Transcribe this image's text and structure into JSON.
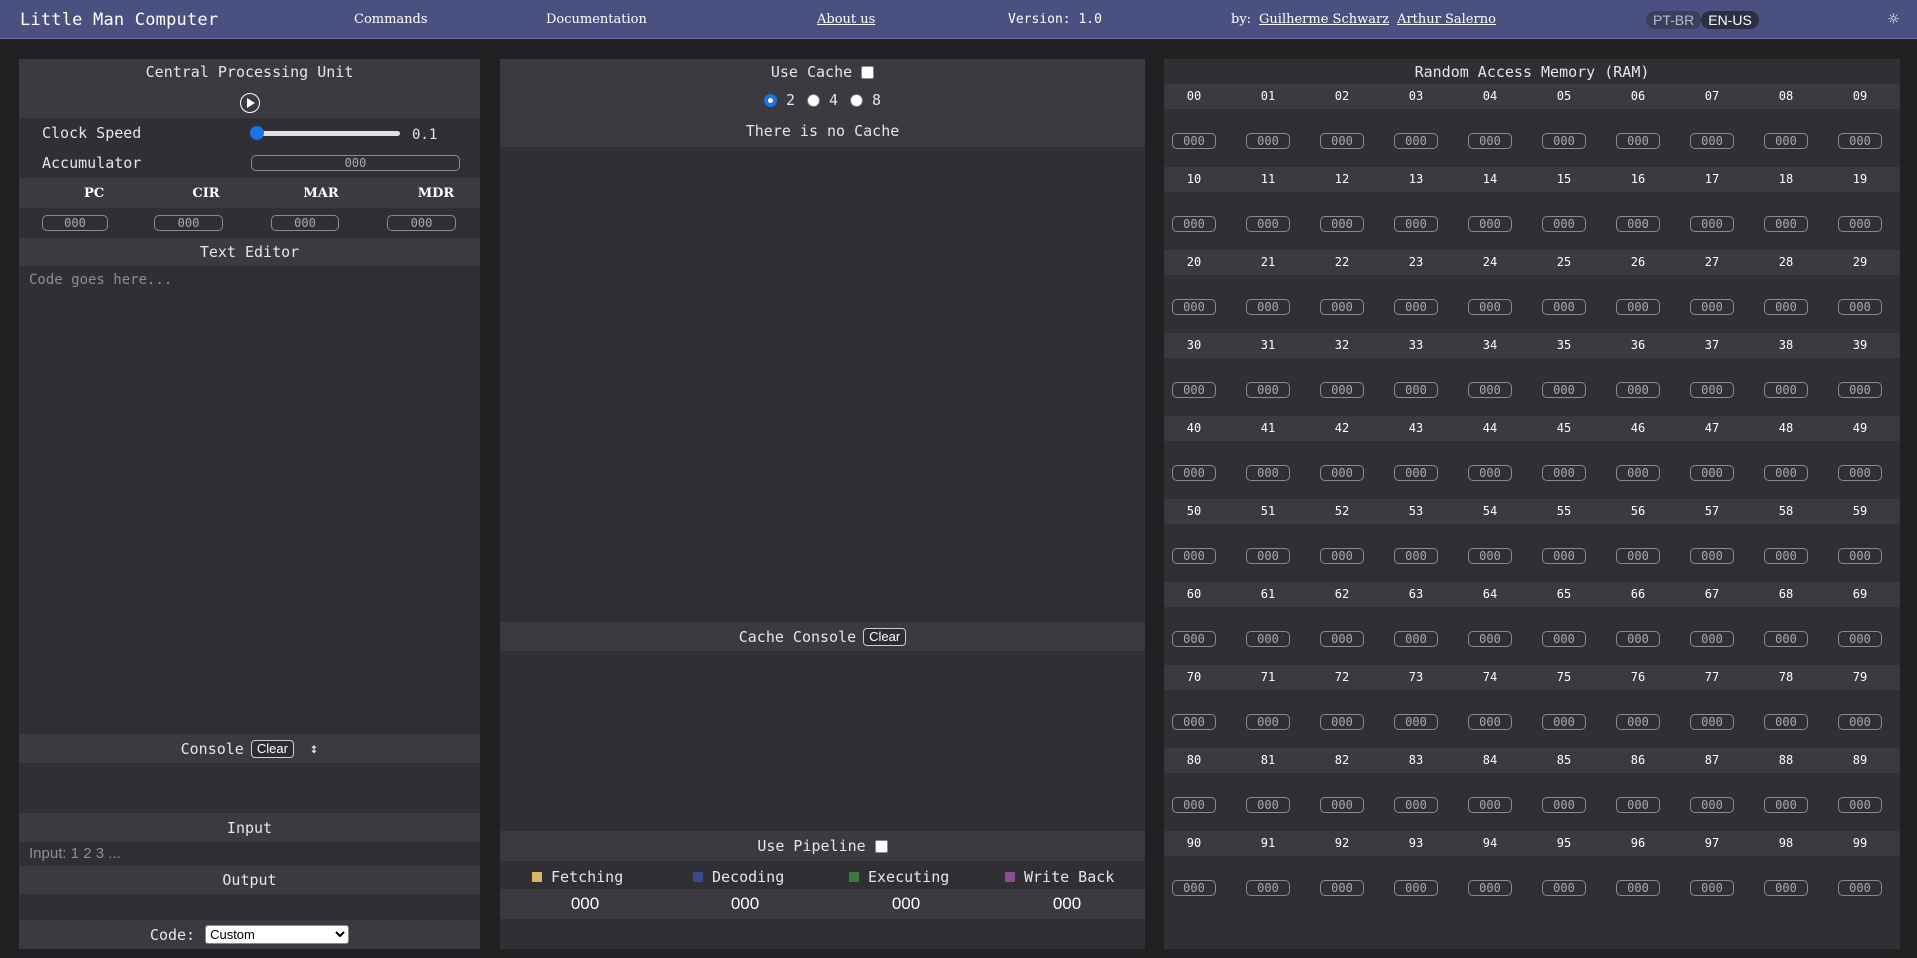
{
  "nav": {
    "brand": "Little Man Computer",
    "commands": "Commands",
    "documentation": "Documentation",
    "about": "About us",
    "version": "Version: 1.0",
    "by": "by:",
    "authors": [
      "Guilherme Schwarz",
      "Arthur Salerno"
    ],
    "languages": [
      "PT-BR",
      "EN-US"
    ],
    "active_language": "EN-US",
    "theme_icon": "sun-icon"
  },
  "cpu": {
    "title": "Central Processing Unit",
    "play_icon": "play-circle-icon",
    "clock_label": "Clock Speed",
    "clock_value": "0.1",
    "clock_slider_fraction": 0.0,
    "accumulator_label": "Accumulator",
    "accumulator_value": "000",
    "registers": [
      {
        "label": "PC",
        "value": "000"
      },
      {
        "label": "CIR",
        "value": "000"
      },
      {
        "label": "MAR",
        "value": "000"
      },
      {
        "label": "MDR",
        "value": "000"
      }
    ],
    "text_editor_title": "Text Editor",
    "editor_placeholder": "Code goes here...",
    "console_title": "Console",
    "console_clear": "Clear",
    "console_resize_icon": "resize-vertical-icon",
    "input_title": "Input",
    "input_placeholder": "Input: 1 2 3 ...",
    "output_title": "Output",
    "code_label": "Code:",
    "code_selected": "Custom"
  },
  "cache": {
    "use_cache_label": "Use Cache",
    "sizes": [
      "2",
      "4",
      "8"
    ],
    "selected_size": "2",
    "empty_message": "There is no Cache",
    "console_title": "Cache Console",
    "console_clear": "Clear",
    "pipeline_label": "Use Pipeline",
    "stages": [
      {
        "name": "Fetching",
        "value": "000",
        "color": "#d6b95e"
      },
      {
        "name": "Decoding",
        "value": "000",
        "color": "#3a4a8a"
      },
      {
        "name": "Executing",
        "value": "000",
        "color": "#3d7a3d"
      },
      {
        "name": "Write Back",
        "value": "000",
        "color": "#8a4f8f"
      }
    ]
  },
  "ram": {
    "title": "Random Access Memory (RAM)",
    "default_value": "000",
    "addresses": [
      "00",
      "01",
      "02",
      "03",
      "04",
      "05",
      "06",
      "07",
      "08",
      "09",
      "10",
      "11",
      "12",
      "13",
      "14",
      "15",
      "16",
      "17",
      "18",
      "19",
      "20",
      "21",
      "22",
      "23",
      "24",
      "25",
      "26",
      "27",
      "28",
      "29",
      "30",
      "31",
      "32",
      "33",
      "34",
      "35",
      "36",
      "37",
      "38",
      "39",
      "40",
      "41",
      "42",
      "43",
      "44",
      "45",
      "46",
      "47",
      "48",
      "49",
      "50",
      "51",
      "52",
      "53",
      "54",
      "55",
      "56",
      "57",
      "58",
      "59",
      "60",
      "61",
      "62",
      "63",
      "64",
      "65",
      "66",
      "67",
      "68",
      "69",
      "70",
      "71",
      "72",
      "73",
      "74",
      "75",
      "76",
      "77",
      "78",
      "79",
      "80",
      "81",
      "82",
      "83",
      "84",
      "85",
      "86",
      "87",
      "88",
      "89",
      "90",
      "91",
      "92",
      "93",
      "94",
      "95",
      "96",
      "97",
      "98",
      "99"
    ],
    "values": [
      "000",
      "000",
      "000",
      "000",
      "000",
      "000",
      "000",
      "000",
      "000",
      "000",
      "000",
      "000",
      "000",
      "000",
      "000",
      "000",
      "000",
      "000",
      "000",
      "000",
      "000",
      "000",
      "000",
      "000",
      "000",
      "000",
      "000",
      "000",
      "000",
      "000",
      "000",
      "000",
      "000",
      "000",
      "000",
      "000",
      "000",
      "000",
      "000",
      "000",
      "000",
      "000",
      "000",
      "000",
      "000",
      "000",
      "000",
      "000",
      "000",
      "000",
      "000",
      "000",
      "000",
      "000",
      "000",
      "000",
      "000",
      "000",
      "000",
      "000",
      "000",
      "000",
      "000",
      "000",
      "000",
      "000",
      "000",
      "000",
      "000",
      "000",
      "000",
      "000",
      "000",
      "000",
      "000",
      "000",
      "000",
      "000",
      "000",
      "000",
      "000",
      "000",
      "000",
      "000",
      "000",
      "000",
      "000",
      "000",
      "000",
      "000",
      "000",
      "000",
      "000",
      "000",
      "000",
      "000",
      "000",
      "000",
      "000",
      "000"
    ]
  }
}
